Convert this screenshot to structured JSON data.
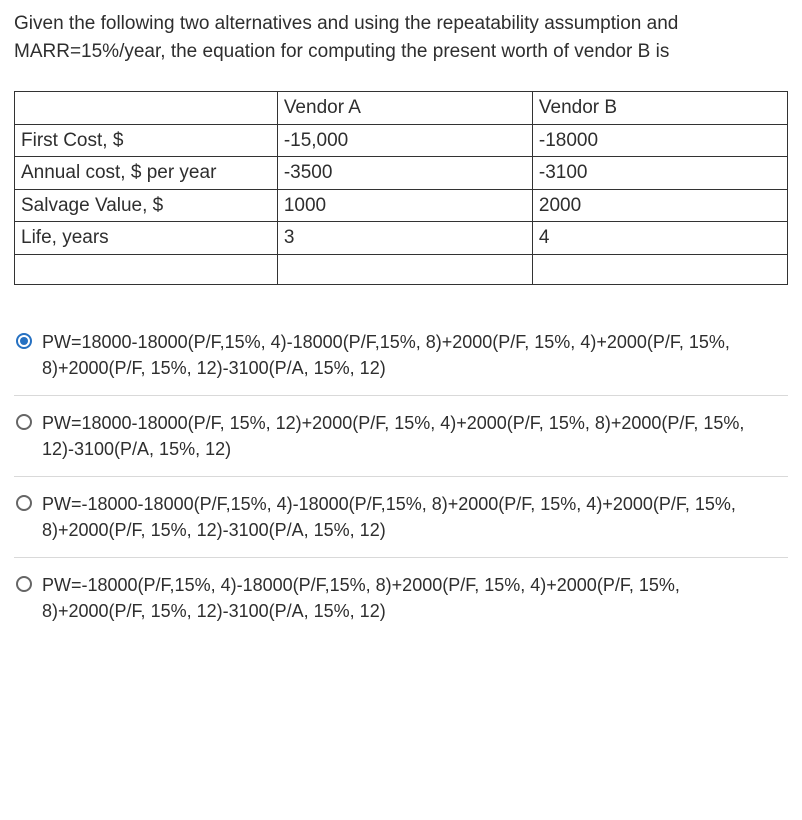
{
  "question": "Given the following two alternatives and using the repeatability assumption and MARR=15%/year, the equation for computing the present worth of vendor B is",
  "table": {
    "headers": [
      "",
      "Vendor A",
      "Vendor B"
    ],
    "rows": [
      {
        "label": "First Cost, $",
        "a": "-15,000",
        "b": "-18000"
      },
      {
        "label": "Annual cost, $ per year",
        "a": "-3500",
        "b": "-3100"
      },
      {
        "label": "Salvage Value, $",
        "a": "1000",
        "b": "2000"
      },
      {
        "label": "Life, years",
        "a": "3",
        "b": "4"
      }
    ]
  },
  "options": [
    {
      "text": "PW=18000-18000(P/F,15%, 4)-18000(P/F,15%, 8)+2000(P/F, 15%, 4)+2000(P/F, 15%, 8)+2000(P/F, 15%, 12)-3100(P/A, 15%, 12)",
      "selected": true
    },
    {
      "text": "PW=18000-18000(P/F, 15%, 12)+2000(P/F, 15%, 4)+2000(P/F, 15%, 8)+2000(P/F, 15%, 12)-3100(P/A, 15%, 12)",
      "selected": false
    },
    {
      "text": "PW=-18000-18000(P/F,15%, 4)-18000(P/F,15%, 8)+2000(P/F, 15%, 4)+2000(P/F, 15%, 8)+2000(P/F, 15%, 12)-3100(P/A, 15%, 12)",
      "selected": false
    },
    {
      "text": "PW=-18000(P/F,15%, 4)-18000(P/F,15%, 8)+2000(P/F, 15%, 4)+2000(P/F, 15%, 8)+2000(P/F, 15%, 12)-3100(P/A, 15%, 12)",
      "selected": false
    }
  ]
}
